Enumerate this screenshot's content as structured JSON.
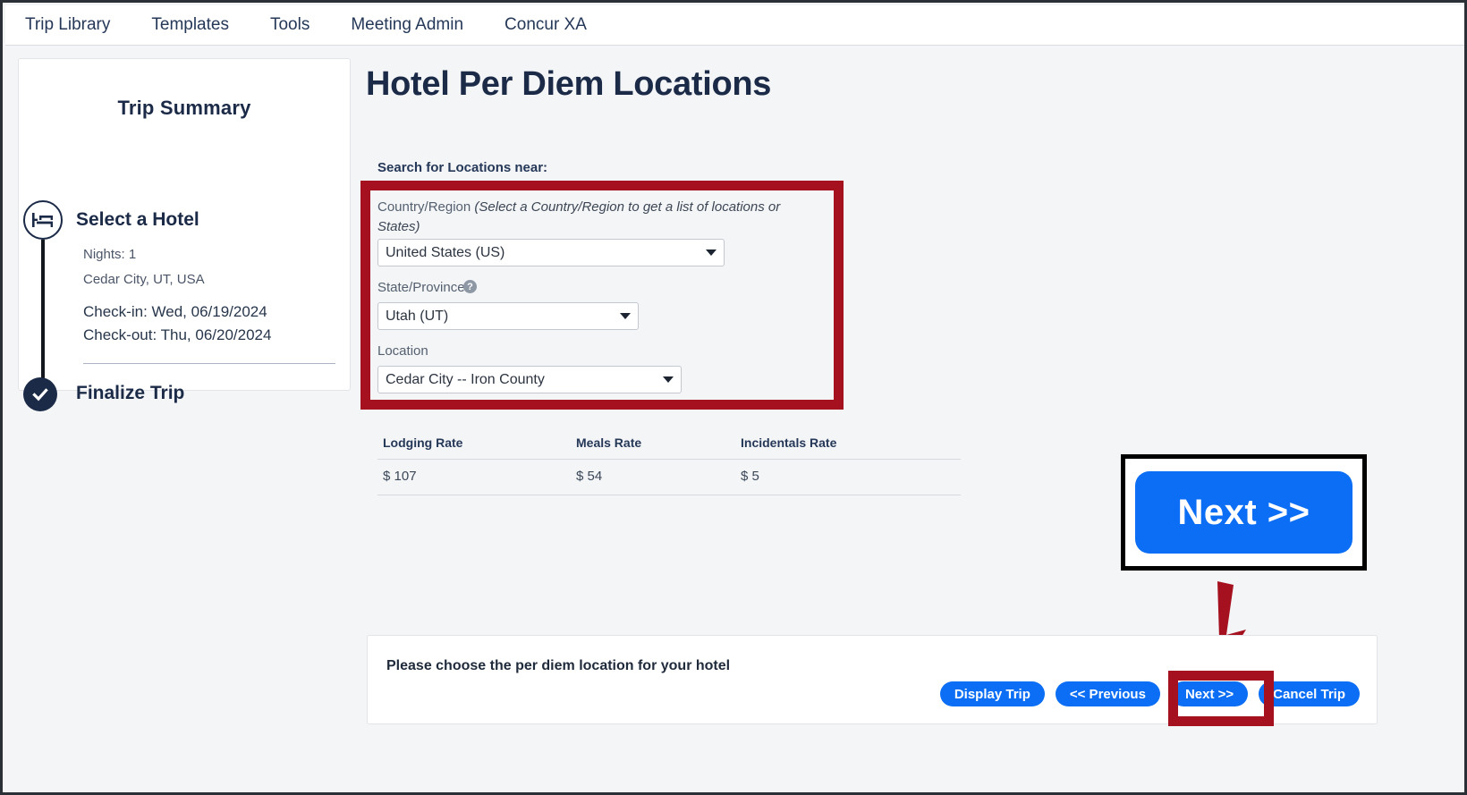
{
  "nav": {
    "items": [
      {
        "label": "Trip Library"
      },
      {
        "label": "Templates"
      },
      {
        "label": "Tools"
      },
      {
        "label": "Meeting Admin"
      },
      {
        "label": "Concur XA"
      }
    ]
  },
  "sidebar": {
    "title": "Trip Summary",
    "steps": [
      {
        "label": "Select a Hotel",
        "icon": "hotel-bed-icon"
      },
      {
        "label": "Finalize Trip",
        "icon": "check-circle-icon"
      }
    ],
    "details": {
      "nights": "Nights: 1",
      "city": "Cedar City, UT, USA",
      "check_in": "Check-in: Wed, 06/19/2024",
      "check_out": "Check-out: Thu, 06/20/2024"
    }
  },
  "main": {
    "title": "Hotel Per Diem Locations",
    "search_label": "Search for Locations near:",
    "form": {
      "country": {
        "label": "Country/Region ",
        "hint": "(Select a Country/Region to get a list of locations or States)",
        "value": "United States (US)"
      },
      "state": {
        "label": "State/Province",
        "help_icon": "help-question-icon",
        "value": "Utah (UT)"
      },
      "location": {
        "label": "Location",
        "value": "Cedar City -- Iron County"
      }
    }
  },
  "rates_table": {
    "headers": [
      "Lodging Rate",
      "Meals Rate",
      "Incidentals Rate"
    ],
    "rows": [
      [
        "$ 107",
        "$ 54",
        "$ 5"
      ]
    ]
  },
  "callout": {
    "button_label": "Next >>"
  },
  "bottom": {
    "status": "Please choose the per diem location for your hotel",
    "buttons": [
      {
        "label": "Display Trip"
      },
      {
        "label": "<< Previous"
      },
      {
        "label": "Next >>"
      },
      {
        "label": "Cancel Trip"
      }
    ]
  },
  "annotations": {
    "highlight_color": "#a5111f",
    "arrow": "down-arrow-annotation",
    "callout_border_color": "#000000"
  },
  "colors": {
    "accent_blue": "#0b6ef4",
    "dark_navy": "#1b2a47",
    "page_bg": "#f4f5f7"
  }
}
